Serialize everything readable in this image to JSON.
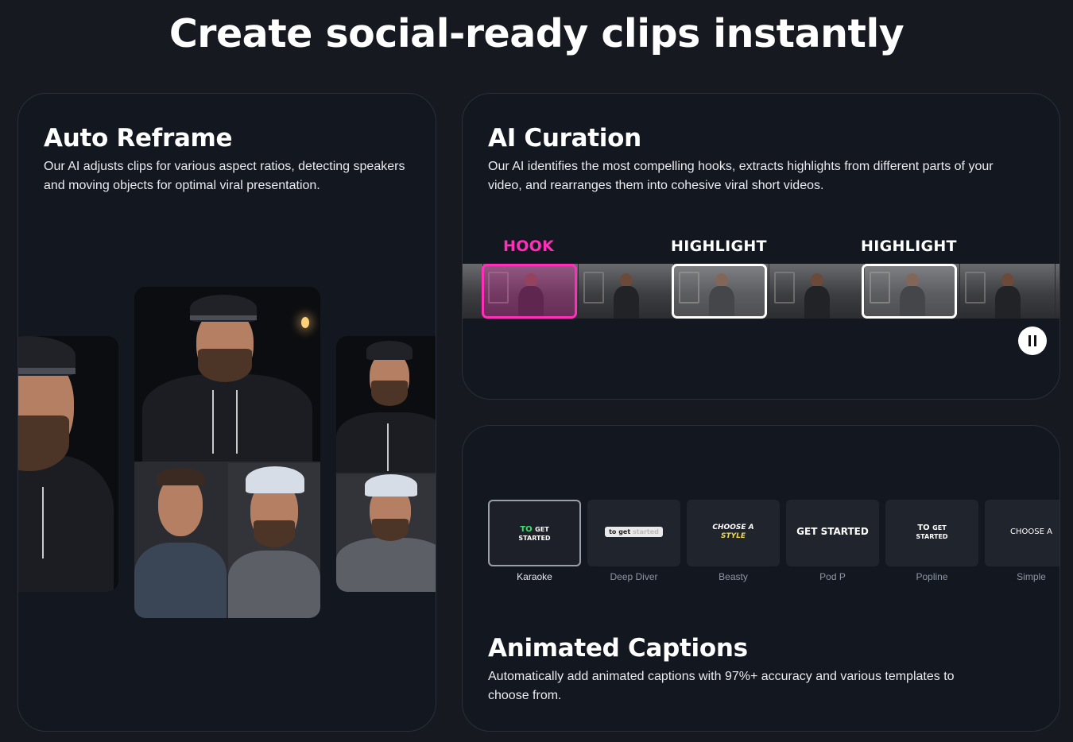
{
  "page": {
    "title": "Create social-ready clips instantly"
  },
  "reframe": {
    "title": "Auto Reframe",
    "description": "Our AI adjusts clips for various aspect ratios, detecting speakers and moving objects for optimal viral presentation."
  },
  "curation": {
    "title": "AI Curation",
    "description": "Our AI identifies the most compelling hooks, extracts highlights from different parts of your video, and rearranges them into cohesive viral short videos.",
    "labels": {
      "hook": "HOOK",
      "highlight_1": "HIGHLIGHT",
      "highlight_2": "HIGHLIGHT"
    },
    "colors": {
      "hook": "#ff2fb9",
      "highlight": "#ffffff"
    },
    "player": {
      "state": "playing",
      "control_icon": "pause-icon"
    }
  },
  "captions": {
    "title": "Animated Captions",
    "description": "Automatically add animated captions with 97%+ accuracy and various templates to choose from.",
    "styles": [
      {
        "name": "Karaoke",
        "preview_a": "TO",
        "preview_b": "GET",
        "preview_c": "STARTED",
        "selected": true
      },
      {
        "name": "Deep Diver",
        "preview_a": "to get",
        "preview_b": "started",
        "selected": false
      },
      {
        "name": "Beasty",
        "preview_a": "CHOOSE A",
        "preview_b": "STYLE",
        "selected": false
      },
      {
        "name": "Pod P",
        "preview_a": "GET STARTED",
        "selected": false
      },
      {
        "name": "Popline",
        "preview_a": "TO",
        "preview_b": "GET",
        "preview_c": "STARTED",
        "selected": false
      },
      {
        "name": "Simple",
        "preview_a": "CHOOSE A",
        "selected": false
      }
    ]
  }
}
